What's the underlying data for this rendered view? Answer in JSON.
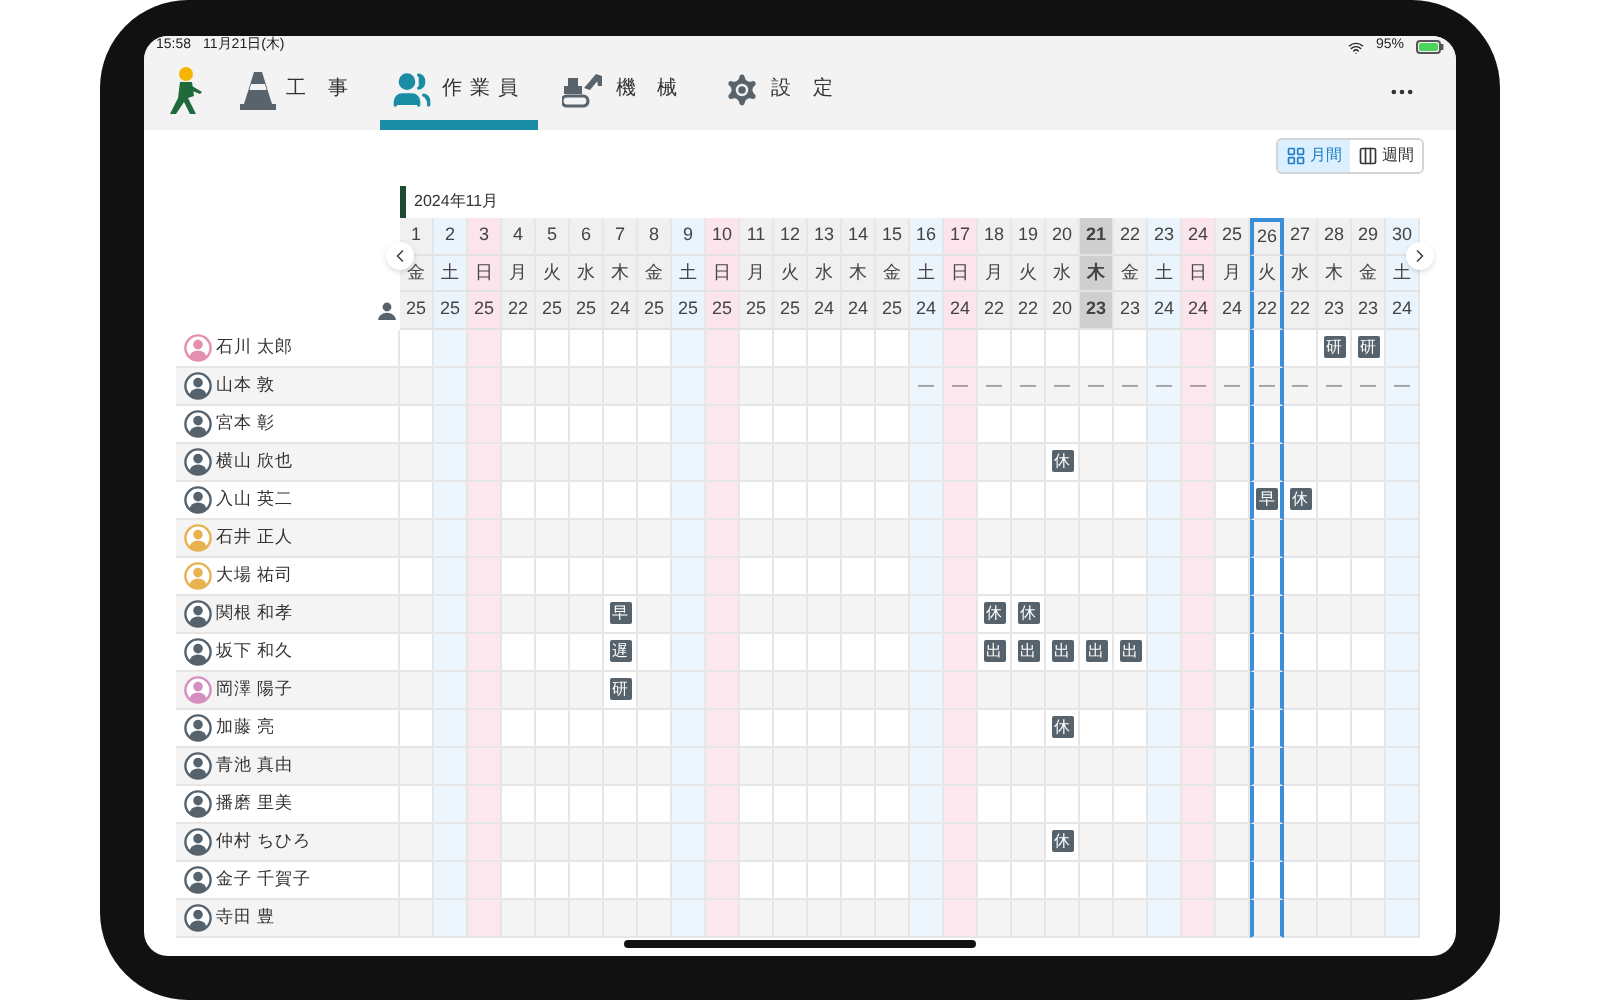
{
  "status_bar": {
    "time": "15:58",
    "date": "11月21日(木)",
    "battery": "95%"
  },
  "nav": {
    "tabs": [
      {
        "label": "工 事",
        "kind": "cone",
        "selected": false
      },
      {
        "label": "作業員",
        "kind": "people",
        "selected": true
      },
      {
        "label": "機 械",
        "kind": "machine",
        "selected": false
      },
      {
        "label": "設 定",
        "kind": "gear",
        "selected": false
      }
    ]
  },
  "view_toggle": [
    {
      "label": "月間",
      "selected": true
    },
    {
      "label": "週間",
      "selected": false
    }
  ],
  "calendar": {
    "month": "2024年11月",
    "days": [
      {
        "date": "1",
        "weekday": "金",
        "count": "25",
        "kind": "weekday",
        "today": false,
        "selected": false
      },
      {
        "date": "2",
        "weekday": "土",
        "count": "25",
        "kind": "saturday",
        "today": false,
        "selected": false
      },
      {
        "date": "3",
        "weekday": "日",
        "count": "25",
        "kind": "sunday",
        "today": false,
        "selected": false
      },
      {
        "date": "4",
        "weekday": "月",
        "count": "22",
        "kind": "weekday",
        "today": false,
        "selected": false
      },
      {
        "date": "5",
        "weekday": "火",
        "count": "25",
        "kind": "weekday",
        "today": false,
        "selected": false
      },
      {
        "date": "6",
        "weekday": "水",
        "count": "25",
        "kind": "weekday",
        "today": false,
        "selected": false
      },
      {
        "date": "7",
        "weekday": "木",
        "count": "24",
        "kind": "weekday",
        "today": false,
        "selected": false
      },
      {
        "date": "8",
        "weekday": "金",
        "count": "25",
        "kind": "weekday",
        "today": false,
        "selected": false
      },
      {
        "date": "9",
        "weekday": "土",
        "count": "25",
        "kind": "saturday",
        "today": false,
        "selected": false
      },
      {
        "date": "10",
        "weekday": "日",
        "count": "25",
        "kind": "sunday",
        "today": false,
        "selected": false
      },
      {
        "date": "11",
        "weekday": "月",
        "count": "25",
        "kind": "weekday",
        "today": false,
        "selected": false
      },
      {
        "date": "12",
        "weekday": "火",
        "count": "25",
        "kind": "weekday",
        "today": false,
        "selected": false
      },
      {
        "date": "13",
        "weekday": "水",
        "count": "24",
        "kind": "weekday",
        "today": false,
        "selected": false
      },
      {
        "date": "14",
        "weekday": "木",
        "count": "24",
        "kind": "weekday",
        "today": false,
        "selected": false
      },
      {
        "date": "15",
        "weekday": "金",
        "count": "25",
        "kind": "weekday",
        "today": false,
        "selected": false
      },
      {
        "date": "16",
        "weekday": "土",
        "count": "24",
        "kind": "saturday",
        "today": false,
        "selected": false
      },
      {
        "date": "17",
        "weekday": "日",
        "count": "24",
        "kind": "sunday",
        "today": false,
        "selected": false
      },
      {
        "date": "18",
        "weekday": "月",
        "count": "22",
        "kind": "weekday",
        "today": false,
        "selected": false
      },
      {
        "date": "19",
        "weekday": "火",
        "count": "22",
        "kind": "weekday",
        "today": false,
        "selected": false
      },
      {
        "date": "20",
        "weekday": "水",
        "count": "20",
        "kind": "weekday",
        "today": false,
        "selected": false
      },
      {
        "date": "21",
        "weekday": "木",
        "count": "23",
        "kind": "weekday",
        "today": true,
        "selected": false
      },
      {
        "date": "22",
        "weekday": "金",
        "count": "23",
        "kind": "weekday",
        "today": false,
        "selected": false
      },
      {
        "date": "23",
        "weekday": "土",
        "count": "24",
        "kind": "saturday",
        "today": false,
        "selected": false
      },
      {
        "date": "24",
        "weekday": "日",
        "count": "24",
        "kind": "sunday",
        "today": false,
        "selected": false
      },
      {
        "date": "25",
        "weekday": "月",
        "count": "24",
        "kind": "weekday",
        "today": false,
        "selected": false
      },
      {
        "date": "26",
        "weekday": "火",
        "count": "22",
        "kind": "weekday",
        "today": false,
        "selected": true
      },
      {
        "date": "27",
        "weekday": "水",
        "count": "22",
        "kind": "weekday",
        "today": false,
        "selected": false
      },
      {
        "date": "28",
        "weekday": "木",
        "count": "23",
        "kind": "weekday",
        "today": false,
        "selected": false
      },
      {
        "date": "29",
        "weekday": "金",
        "count": "23",
        "kind": "weekday",
        "today": false,
        "selected": false
      },
      {
        "date": "30",
        "weekday": "土",
        "count": "24",
        "kind": "saturday",
        "today": false,
        "selected": false
      }
    ]
  },
  "members": [
    {
      "name": "石川 太郎",
      "color": "#e58fb0",
      "cells": [
        {
          "kind": "blank"
        },
        {
          "kind": "blank"
        },
        {
          "kind": "blank"
        },
        {
          "kind": "blank"
        },
        {
          "kind": "blank"
        },
        {
          "kind": "blank"
        },
        {
          "kind": "blank"
        },
        {
          "kind": "blank"
        },
        {
          "kind": "blank"
        },
        {
          "kind": "blank"
        },
        {
          "kind": "blank"
        },
        {
          "kind": "blank"
        },
        {
          "kind": "blank"
        },
        {
          "kind": "blank"
        },
        {
          "kind": "blank"
        },
        {
          "kind": "blank"
        },
        {
          "kind": "blank"
        },
        {
          "kind": "blank"
        },
        {
          "kind": "blank"
        },
        {
          "kind": "blank"
        },
        {
          "kind": "blank"
        },
        {
          "kind": "blank"
        },
        {
          "kind": "blank"
        },
        {
          "kind": "blank"
        },
        {
          "kind": "blank"
        },
        {
          "kind": "blank"
        },
        {
          "kind": "blank"
        },
        {
          "kind": "badge",
          "label": "研"
        },
        {
          "kind": "badge",
          "label": "研"
        },
        {
          "kind": "blank"
        }
      ]
    },
    {
      "name": "山本 敦",
      "color": "#56626c",
      "cells": [
        {
          "kind": "blank"
        },
        {
          "kind": "blank"
        },
        {
          "kind": "blank"
        },
        {
          "kind": "blank"
        },
        {
          "kind": "blank"
        },
        {
          "kind": "blank"
        },
        {
          "kind": "blank"
        },
        {
          "kind": "blank"
        },
        {
          "kind": "blank"
        },
        {
          "kind": "blank"
        },
        {
          "kind": "blank"
        },
        {
          "kind": "blank"
        },
        {
          "kind": "blank"
        },
        {
          "kind": "blank"
        },
        {
          "kind": "blank"
        },
        {
          "kind": "dash",
          "label": "—"
        },
        {
          "kind": "dash",
          "label": "—"
        },
        {
          "kind": "dash",
          "label": "—"
        },
        {
          "kind": "dash",
          "label": "—"
        },
        {
          "kind": "dash",
          "label": "—"
        },
        {
          "kind": "dash",
          "label": "—"
        },
        {
          "kind": "dash",
          "label": "—"
        },
        {
          "kind": "dash",
          "label": "—"
        },
        {
          "kind": "dash",
          "label": "—"
        },
        {
          "kind": "dash",
          "label": "—"
        },
        {
          "kind": "dash",
          "label": "—"
        },
        {
          "kind": "dash",
          "label": "—"
        },
        {
          "kind": "dash",
          "label": "—"
        },
        {
          "kind": "dash",
          "label": "—"
        },
        {
          "kind": "dash",
          "label": "—"
        }
      ]
    },
    {
      "name": "宮本 彰",
      "color": "#56626c",
      "cells": [
        {
          "kind": "blank"
        },
        {
          "kind": "blank"
        },
        {
          "kind": "blank"
        },
        {
          "kind": "blank"
        },
        {
          "kind": "blank"
        },
        {
          "kind": "blank"
        },
        {
          "kind": "blank"
        },
        {
          "kind": "blank"
        },
        {
          "kind": "blank"
        },
        {
          "kind": "blank"
        },
        {
          "kind": "blank"
        },
        {
          "kind": "blank"
        },
        {
          "kind": "blank"
        },
        {
          "kind": "blank"
        },
        {
          "kind": "blank"
        },
        {
          "kind": "blank"
        },
        {
          "kind": "blank"
        },
        {
          "kind": "blank"
        },
        {
          "kind": "blank"
        },
        {
          "kind": "blank"
        },
        {
          "kind": "blank"
        },
        {
          "kind": "blank"
        },
        {
          "kind": "blank"
        },
        {
          "kind": "blank"
        },
        {
          "kind": "blank"
        },
        {
          "kind": "blank"
        },
        {
          "kind": "blank"
        },
        {
          "kind": "blank"
        },
        {
          "kind": "blank"
        },
        {
          "kind": "blank"
        }
      ]
    },
    {
      "name": "横山 欣也",
      "color": "#56626c",
      "cells": [
        {
          "kind": "blank"
        },
        {
          "kind": "blank"
        },
        {
          "kind": "blank"
        },
        {
          "kind": "blank"
        },
        {
          "kind": "blank"
        },
        {
          "kind": "blank"
        },
        {
          "kind": "blank"
        },
        {
          "kind": "blank"
        },
        {
          "kind": "blank"
        },
        {
          "kind": "blank"
        },
        {
          "kind": "blank"
        },
        {
          "kind": "blank"
        },
        {
          "kind": "blank"
        },
        {
          "kind": "blank"
        },
        {
          "kind": "blank"
        },
        {
          "kind": "blank"
        },
        {
          "kind": "blank"
        },
        {
          "kind": "blank"
        },
        {
          "kind": "blank"
        },
        {
          "kind": "badge",
          "label": "休"
        },
        {
          "kind": "blank"
        },
        {
          "kind": "blank"
        },
        {
          "kind": "blank"
        },
        {
          "kind": "blank"
        },
        {
          "kind": "blank"
        },
        {
          "kind": "blank"
        },
        {
          "kind": "blank"
        },
        {
          "kind": "blank"
        },
        {
          "kind": "blank"
        },
        {
          "kind": "blank"
        }
      ]
    },
    {
      "name": "入山 英二",
      "color": "#56626c",
      "cells": [
        {
          "kind": "blank"
        },
        {
          "kind": "blank"
        },
        {
          "kind": "blank"
        },
        {
          "kind": "blank"
        },
        {
          "kind": "blank"
        },
        {
          "kind": "blank"
        },
        {
          "kind": "blank"
        },
        {
          "kind": "blank"
        },
        {
          "kind": "blank"
        },
        {
          "kind": "blank"
        },
        {
          "kind": "blank"
        },
        {
          "kind": "blank"
        },
        {
          "kind": "blank"
        },
        {
          "kind": "blank"
        },
        {
          "kind": "blank"
        },
        {
          "kind": "blank"
        },
        {
          "kind": "blank"
        },
        {
          "kind": "blank"
        },
        {
          "kind": "blank"
        },
        {
          "kind": "blank"
        },
        {
          "kind": "blank"
        },
        {
          "kind": "blank"
        },
        {
          "kind": "blank"
        },
        {
          "kind": "blank"
        },
        {
          "kind": "blank"
        },
        {
          "kind": "badge",
          "label": "早"
        },
        {
          "kind": "badge",
          "label": "休"
        },
        {
          "kind": "blank"
        },
        {
          "kind": "blank"
        },
        {
          "kind": "blank"
        }
      ]
    },
    {
      "name": "石井 正人",
      "color": "#e8b34f",
      "cells": [
        {
          "kind": "blank"
        },
        {
          "kind": "blank"
        },
        {
          "kind": "blank"
        },
        {
          "kind": "blank"
        },
        {
          "kind": "blank"
        },
        {
          "kind": "blank"
        },
        {
          "kind": "blank"
        },
        {
          "kind": "blank"
        },
        {
          "kind": "blank"
        },
        {
          "kind": "blank"
        },
        {
          "kind": "blank"
        },
        {
          "kind": "blank"
        },
        {
          "kind": "blank"
        },
        {
          "kind": "blank"
        },
        {
          "kind": "blank"
        },
        {
          "kind": "blank"
        },
        {
          "kind": "blank"
        },
        {
          "kind": "blank"
        },
        {
          "kind": "blank"
        },
        {
          "kind": "blank"
        },
        {
          "kind": "blank"
        },
        {
          "kind": "blank"
        },
        {
          "kind": "blank"
        },
        {
          "kind": "blank"
        },
        {
          "kind": "blank"
        },
        {
          "kind": "blank"
        },
        {
          "kind": "blank"
        },
        {
          "kind": "blank"
        },
        {
          "kind": "blank"
        },
        {
          "kind": "blank"
        }
      ]
    },
    {
      "name": "大場 祐司",
      "color": "#e8b34f",
      "cells": [
        {
          "kind": "blank"
        },
        {
          "kind": "blank"
        },
        {
          "kind": "blank"
        },
        {
          "kind": "blank"
        },
        {
          "kind": "blank"
        },
        {
          "kind": "blank"
        },
        {
          "kind": "blank"
        },
        {
          "kind": "blank"
        },
        {
          "kind": "blank"
        },
        {
          "kind": "blank"
        },
        {
          "kind": "blank"
        },
        {
          "kind": "blank"
        },
        {
          "kind": "blank"
        },
        {
          "kind": "blank"
        },
        {
          "kind": "blank"
        },
        {
          "kind": "blank"
        },
        {
          "kind": "blank"
        },
        {
          "kind": "blank"
        },
        {
          "kind": "blank"
        },
        {
          "kind": "blank"
        },
        {
          "kind": "blank"
        },
        {
          "kind": "blank"
        },
        {
          "kind": "blank"
        },
        {
          "kind": "blank"
        },
        {
          "kind": "blank"
        },
        {
          "kind": "blank"
        },
        {
          "kind": "blank"
        },
        {
          "kind": "blank"
        },
        {
          "kind": "blank"
        },
        {
          "kind": "blank"
        }
      ]
    },
    {
      "name": "関根 和孝",
      "color": "#56626c",
      "cells": [
        {
          "kind": "blank"
        },
        {
          "kind": "blank"
        },
        {
          "kind": "blank"
        },
        {
          "kind": "blank"
        },
        {
          "kind": "blank"
        },
        {
          "kind": "blank"
        },
        {
          "kind": "badge",
          "label": "早"
        },
        {
          "kind": "blank"
        },
        {
          "kind": "blank"
        },
        {
          "kind": "blank"
        },
        {
          "kind": "blank"
        },
        {
          "kind": "blank"
        },
        {
          "kind": "blank"
        },
        {
          "kind": "blank"
        },
        {
          "kind": "blank"
        },
        {
          "kind": "blank"
        },
        {
          "kind": "blank"
        },
        {
          "kind": "badge",
          "label": "休"
        },
        {
          "kind": "badge",
          "label": "休"
        },
        {
          "kind": "blank"
        },
        {
          "kind": "blank"
        },
        {
          "kind": "blank"
        },
        {
          "kind": "blank"
        },
        {
          "kind": "blank"
        },
        {
          "kind": "blank"
        },
        {
          "kind": "blank"
        },
        {
          "kind": "blank"
        },
        {
          "kind": "blank"
        },
        {
          "kind": "blank"
        },
        {
          "kind": "blank"
        }
      ]
    },
    {
      "name": "坂下 和久",
      "color": "#56626c",
      "cells": [
        {
          "kind": "blank"
        },
        {
          "kind": "blank"
        },
        {
          "kind": "blank"
        },
        {
          "kind": "blank"
        },
        {
          "kind": "blank"
        },
        {
          "kind": "blank"
        },
        {
          "kind": "badge",
          "label": "遅"
        },
        {
          "kind": "blank"
        },
        {
          "kind": "blank"
        },
        {
          "kind": "blank"
        },
        {
          "kind": "blank"
        },
        {
          "kind": "blank"
        },
        {
          "kind": "blank"
        },
        {
          "kind": "blank"
        },
        {
          "kind": "blank"
        },
        {
          "kind": "blank"
        },
        {
          "kind": "blank"
        },
        {
          "kind": "badge",
          "label": "出"
        },
        {
          "kind": "badge",
          "label": "出"
        },
        {
          "kind": "badge",
          "label": "出"
        },
        {
          "kind": "badge",
          "label": "出"
        },
        {
          "kind": "badge",
          "label": "出"
        },
        {
          "kind": "blank"
        },
        {
          "kind": "blank"
        },
        {
          "kind": "blank"
        },
        {
          "kind": "blank"
        },
        {
          "kind": "blank"
        },
        {
          "kind": "blank"
        },
        {
          "kind": "blank"
        },
        {
          "kind": "blank"
        }
      ]
    },
    {
      "name": "岡澤 陽子",
      "color": "#d48fc0",
      "cells": [
        {
          "kind": "blank"
        },
        {
          "kind": "blank"
        },
        {
          "kind": "blank"
        },
        {
          "kind": "blank"
        },
        {
          "kind": "blank"
        },
        {
          "kind": "blank"
        },
        {
          "kind": "badge",
          "label": "研"
        },
        {
          "kind": "blank"
        },
        {
          "kind": "blank"
        },
        {
          "kind": "blank"
        },
        {
          "kind": "blank"
        },
        {
          "kind": "blank"
        },
        {
          "kind": "blank"
        },
        {
          "kind": "blank"
        },
        {
          "kind": "blank"
        },
        {
          "kind": "blank"
        },
        {
          "kind": "blank"
        },
        {
          "kind": "blank"
        },
        {
          "kind": "blank"
        },
        {
          "kind": "blank"
        },
        {
          "kind": "blank"
        },
        {
          "kind": "blank"
        },
        {
          "kind": "blank"
        },
        {
          "kind": "blank"
        },
        {
          "kind": "blank"
        },
        {
          "kind": "blank"
        },
        {
          "kind": "blank"
        },
        {
          "kind": "blank"
        },
        {
          "kind": "blank"
        },
        {
          "kind": "blank"
        }
      ]
    },
    {
      "name": "加藤 亮",
      "color": "#56626c",
      "cells": [
        {
          "kind": "blank"
        },
        {
          "kind": "blank"
        },
        {
          "kind": "blank"
        },
        {
          "kind": "blank"
        },
        {
          "kind": "blank"
        },
        {
          "kind": "blank"
        },
        {
          "kind": "blank"
        },
        {
          "kind": "blank"
        },
        {
          "kind": "blank"
        },
        {
          "kind": "blank"
        },
        {
          "kind": "blank"
        },
        {
          "kind": "blank"
        },
        {
          "kind": "blank"
        },
        {
          "kind": "blank"
        },
        {
          "kind": "blank"
        },
        {
          "kind": "blank"
        },
        {
          "kind": "blank"
        },
        {
          "kind": "blank"
        },
        {
          "kind": "blank"
        },
        {
          "kind": "badge",
          "label": "休"
        },
        {
          "kind": "blank"
        },
        {
          "kind": "blank"
        },
        {
          "kind": "blank"
        },
        {
          "kind": "blank"
        },
        {
          "kind": "blank"
        },
        {
          "kind": "blank"
        },
        {
          "kind": "blank"
        },
        {
          "kind": "blank"
        },
        {
          "kind": "blank"
        },
        {
          "kind": "blank"
        }
      ]
    },
    {
      "name": "青池 真由",
      "color": "#56626c",
      "cells": [
        {
          "kind": "blank"
        },
        {
          "kind": "blank"
        },
        {
          "kind": "blank"
        },
        {
          "kind": "blank"
        },
        {
          "kind": "blank"
        },
        {
          "kind": "blank"
        },
        {
          "kind": "blank"
        },
        {
          "kind": "blank"
        },
        {
          "kind": "blank"
        },
        {
          "kind": "blank"
        },
        {
          "kind": "blank"
        },
        {
          "kind": "blank"
        },
        {
          "kind": "blank"
        },
        {
          "kind": "blank"
        },
        {
          "kind": "blank"
        },
        {
          "kind": "blank"
        },
        {
          "kind": "blank"
        },
        {
          "kind": "blank"
        },
        {
          "kind": "blank"
        },
        {
          "kind": "blank"
        },
        {
          "kind": "blank"
        },
        {
          "kind": "blank"
        },
        {
          "kind": "blank"
        },
        {
          "kind": "blank"
        },
        {
          "kind": "blank"
        },
        {
          "kind": "blank"
        },
        {
          "kind": "blank"
        },
        {
          "kind": "blank"
        },
        {
          "kind": "blank"
        },
        {
          "kind": "blank"
        }
      ]
    },
    {
      "name": "播磨 里美",
      "color": "#56626c",
      "cells": [
        {
          "kind": "blank"
        },
        {
          "kind": "blank"
        },
        {
          "kind": "blank"
        },
        {
          "kind": "blank"
        },
        {
          "kind": "blank"
        },
        {
          "kind": "blank"
        },
        {
          "kind": "blank"
        },
        {
          "kind": "blank"
        },
        {
          "kind": "blank"
        },
        {
          "kind": "blank"
        },
        {
          "kind": "blank"
        },
        {
          "kind": "blank"
        },
        {
          "kind": "blank"
        },
        {
          "kind": "blank"
        },
        {
          "kind": "blank"
        },
        {
          "kind": "blank"
        },
        {
          "kind": "blank"
        },
        {
          "kind": "blank"
        },
        {
          "kind": "blank"
        },
        {
          "kind": "blank"
        },
        {
          "kind": "blank"
        },
        {
          "kind": "blank"
        },
        {
          "kind": "blank"
        },
        {
          "kind": "blank"
        },
        {
          "kind": "blank"
        },
        {
          "kind": "blank"
        },
        {
          "kind": "blank"
        },
        {
          "kind": "blank"
        },
        {
          "kind": "blank"
        },
        {
          "kind": "blank"
        }
      ]
    },
    {
      "name": "仲村 ちひろ",
      "color": "#56626c",
      "cells": [
        {
          "kind": "blank"
        },
        {
          "kind": "blank"
        },
        {
          "kind": "blank"
        },
        {
          "kind": "blank"
        },
        {
          "kind": "blank"
        },
        {
          "kind": "blank"
        },
        {
          "kind": "blank"
        },
        {
          "kind": "blank"
        },
        {
          "kind": "blank"
        },
        {
          "kind": "blank"
        },
        {
          "kind": "blank"
        },
        {
          "kind": "blank"
        },
        {
          "kind": "blank"
        },
        {
          "kind": "blank"
        },
        {
          "kind": "blank"
        },
        {
          "kind": "blank"
        },
        {
          "kind": "blank"
        },
        {
          "kind": "blank"
        },
        {
          "kind": "blank"
        },
        {
          "kind": "badge",
          "label": "休"
        },
        {
          "kind": "blank"
        },
        {
          "kind": "blank"
        },
        {
          "kind": "blank"
        },
        {
          "kind": "blank"
        },
        {
          "kind": "blank"
        },
        {
          "kind": "blank"
        },
        {
          "kind": "blank"
        },
        {
          "kind": "blank"
        },
        {
          "kind": "blank"
        },
        {
          "kind": "blank"
        }
      ]
    },
    {
      "name": "金子 千賀子",
      "color": "#56626c",
      "cells": [
        {
          "kind": "blank"
        },
        {
          "kind": "blank"
        },
        {
          "kind": "blank"
        },
        {
          "kind": "blank"
        },
        {
          "kind": "blank"
        },
        {
          "kind": "blank"
        },
        {
          "kind": "blank"
        },
        {
          "kind": "blank"
        },
        {
          "kind": "blank"
        },
        {
          "kind": "blank"
        },
        {
          "kind": "blank"
        },
        {
          "kind": "blank"
        },
        {
          "kind": "blank"
        },
        {
          "kind": "blank"
        },
        {
          "kind": "blank"
        },
        {
          "kind": "blank"
        },
        {
          "kind": "blank"
        },
        {
          "kind": "blank"
        },
        {
          "kind": "blank"
        },
        {
          "kind": "blank"
        },
        {
          "kind": "blank"
        },
        {
          "kind": "blank"
        },
        {
          "kind": "blank"
        },
        {
          "kind": "blank"
        },
        {
          "kind": "blank"
        },
        {
          "kind": "blank"
        },
        {
          "kind": "blank"
        },
        {
          "kind": "blank"
        },
        {
          "kind": "blank"
        },
        {
          "kind": "blank"
        }
      ]
    },
    {
      "name": "寺田 豊",
      "color": "#56626c",
      "cells": [
        {
          "kind": "blank"
        },
        {
          "kind": "blank"
        },
        {
          "kind": "blank"
        },
        {
          "kind": "blank"
        },
        {
          "kind": "blank"
        },
        {
          "kind": "blank"
        },
        {
          "kind": "blank"
        },
        {
          "kind": "blank"
        },
        {
          "kind": "blank"
        },
        {
          "kind": "blank"
        },
        {
          "kind": "blank"
        },
        {
          "kind": "blank"
        },
        {
          "kind": "blank"
        },
        {
          "kind": "blank"
        },
        {
          "kind": "blank"
        },
        {
          "kind": "blank"
        },
        {
          "kind": "blank"
        },
        {
          "kind": "blank"
        },
        {
          "kind": "blank"
        },
        {
          "kind": "blank"
        },
        {
          "kind": "blank"
        },
        {
          "kind": "blank"
        },
        {
          "kind": "blank"
        },
        {
          "kind": "blank"
        },
        {
          "kind": "blank"
        },
        {
          "kind": "blank"
        },
        {
          "kind": "blank"
        },
        {
          "kind": "blank"
        },
        {
          "kind": "blank"
        },
        {
          "kind": "blank"
        }
      ]
    }
  ]
}
